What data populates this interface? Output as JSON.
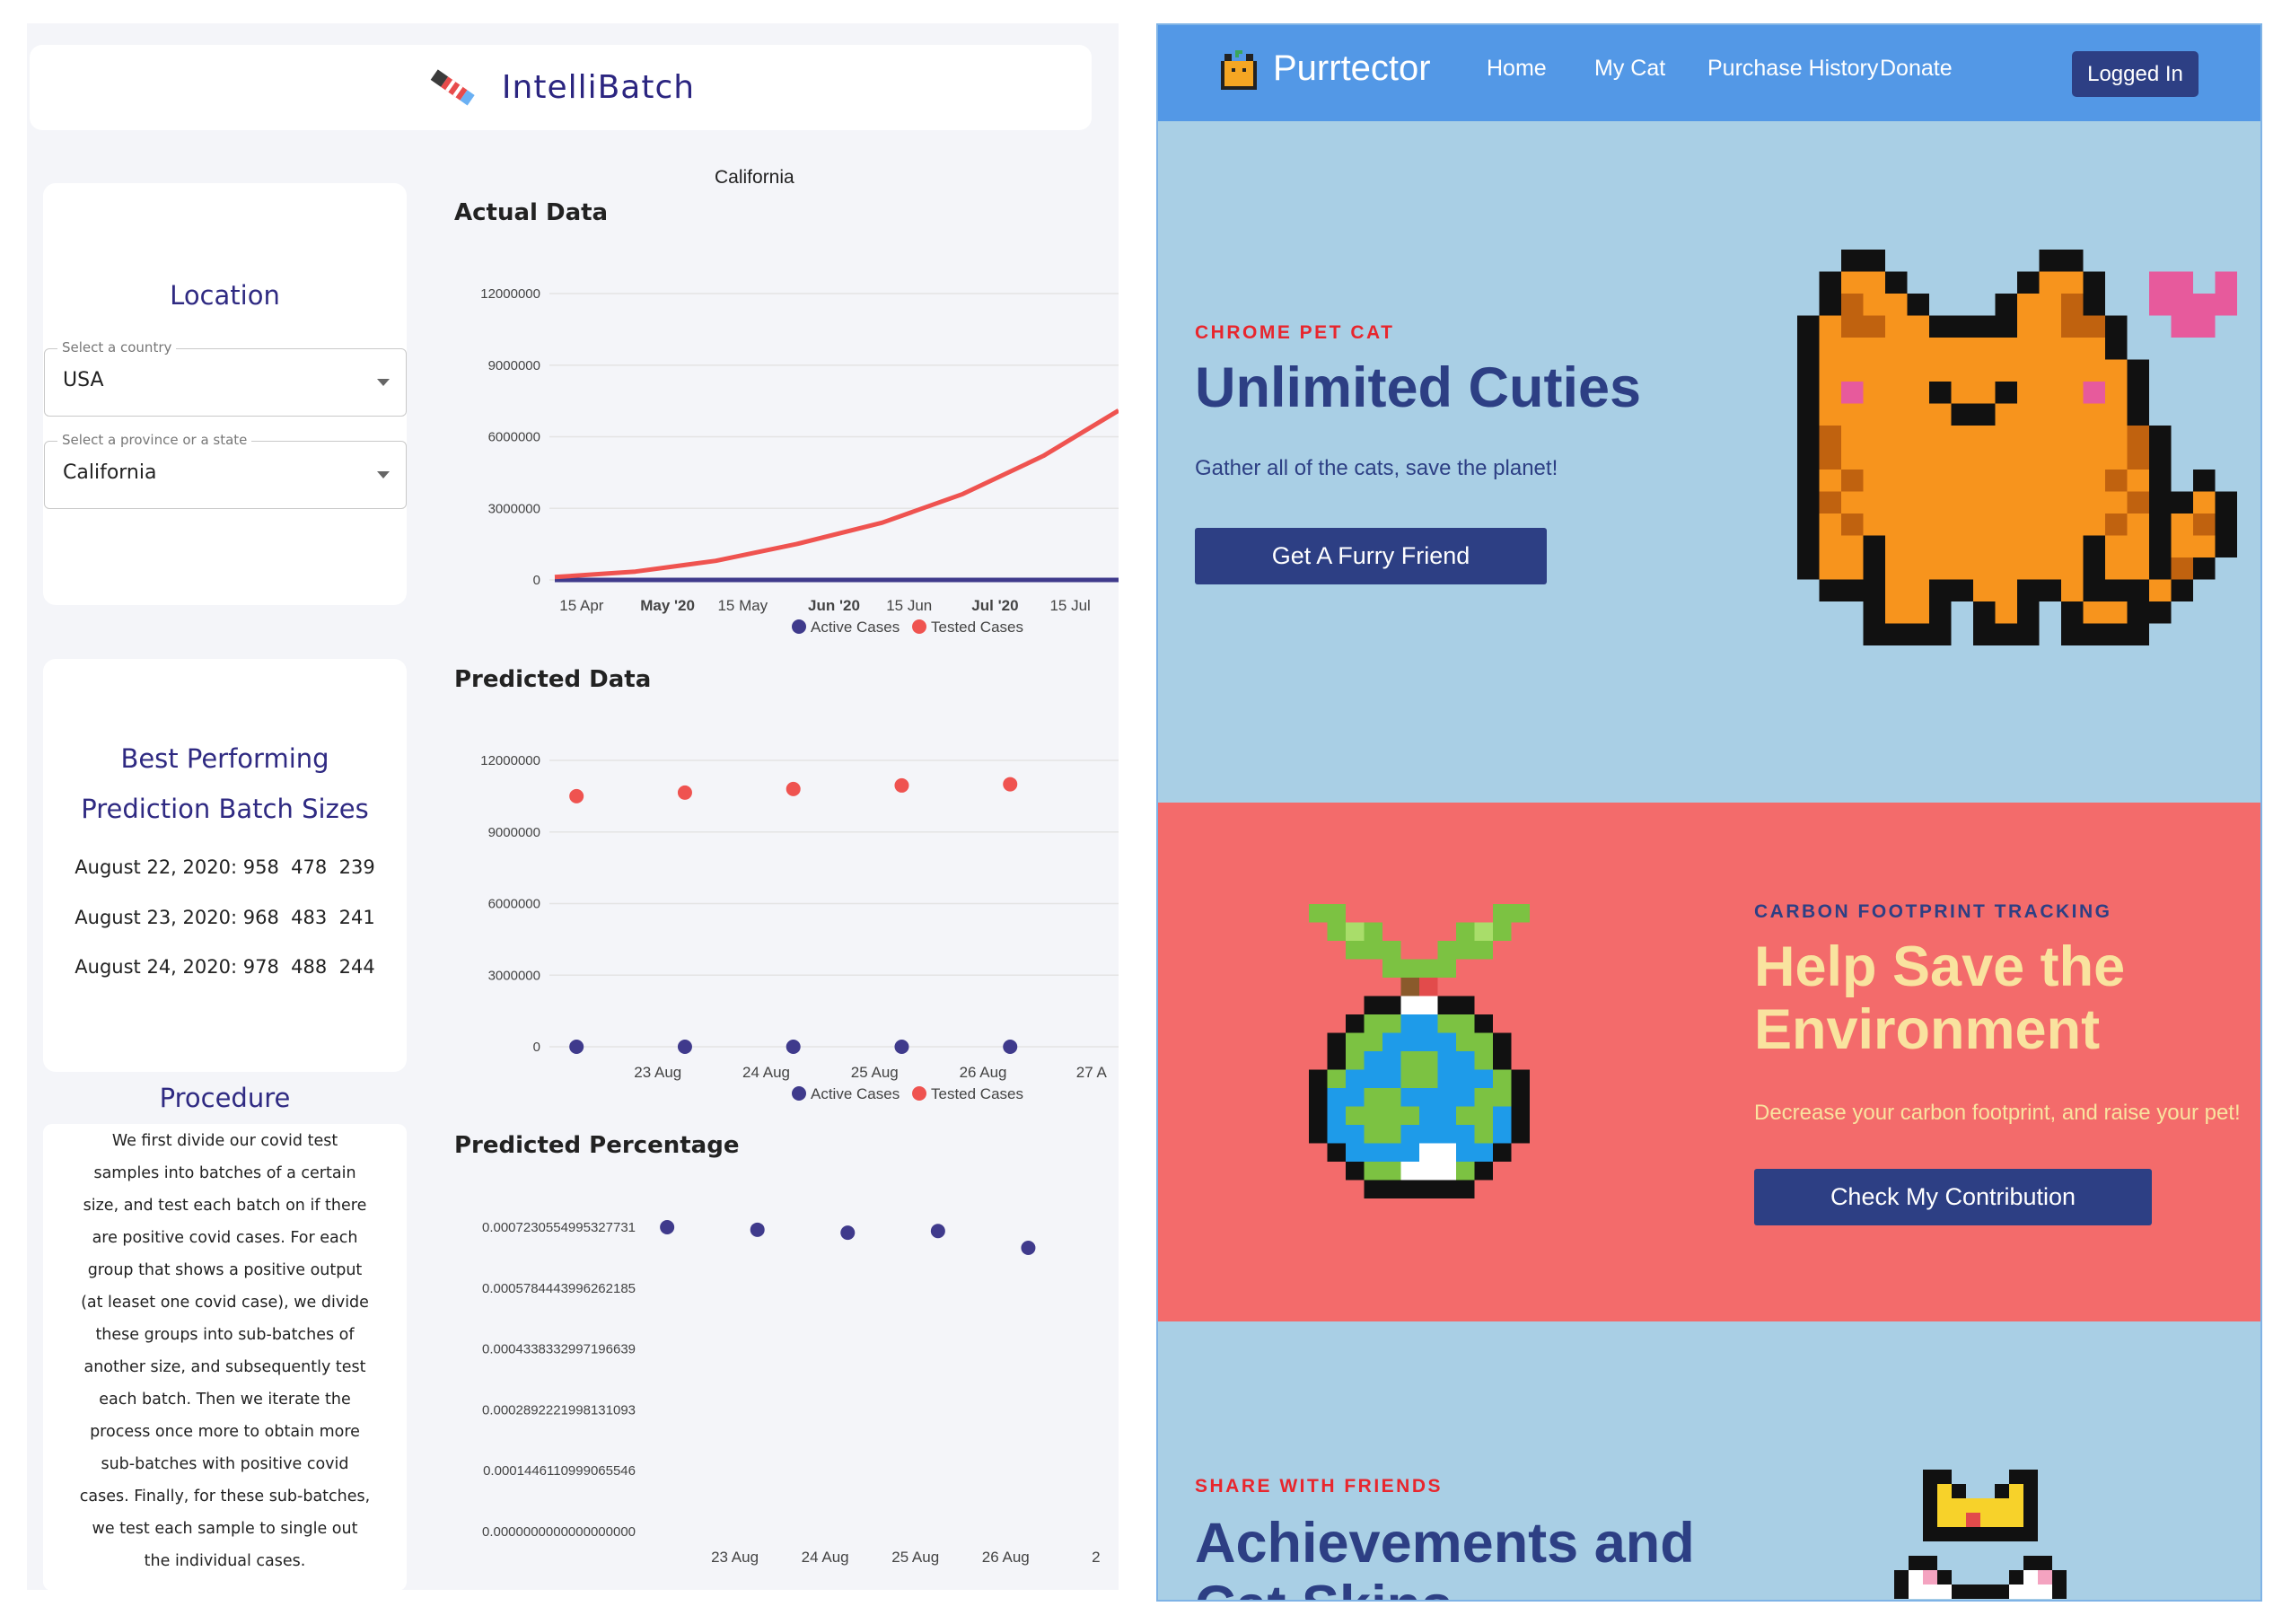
{
  "intellibatch": {
    "brand": "IntelliBatch",
    "location": {
      "title": "Location",
      "country_label": "Select a country",
      "country_value": "USA",
      "state_label": "Select a province or a state",
      "state_value": "California"
    },
    "best": {
      "title_line1": "Best Performing",
      "title_line2": "Prediction Batch Sizes",
      "rows": [
        "August 22, 2020: 958  478  239",
        "August 23, 2020: 968  483  241",
        "August 24, 2020: 978  488  244"
      ]
    },
    "procedure": {
      "title": "Procedure",
      "lines": [
        "We first divide our covid test",
        "samples into batches of a certain",
        "size, and test each batch on if there",
        "are positive covid cases. For each",
        "group that shows a positive output",
        "(at leaset one covid case), we divide",
        "these groups into sub-batches of",
        "another size, and subsequently test",
        "each batch. Then we iterate the",
        "process once more to obtain more",
        "sub-batches with positive covid",
        "cases. Finally, for these sub-batches,",
        "we test each sample to single out",
        "the individual cases."
      ]
    },
    "charts_header": "California",
    "colors": {
      "active": "#3f3a8c",
      "tested": "#ef5350"
    }
  },
  "chart_data": [
    {
      "type": "line",
      "title": "Actual Data",
      "x_ticks": [
        "15 Apr",
        "May '20",
        "15 May",
        "Jun '20",
        "15 Jun",
        "Jul '20",
        "15 Jul"
      ],
      "y_ticks": [
        "12000000",
        "9000000",
        "6000000",
        "3000000",
        "0"
      ],
      "ylim": [
        0,
        12000000
      ],
      "series": [
        {
          "name": "Active Cases",
          "x": [
            "2020-04-10",
            "2020-07-24"
          ],
          "values": [
            0,
            0
          ]
        },
        {
          "name": "Tested Cases",
          "x": [
            "2020-04-10",
            "2020-04-25",
            "2020-05-10",
            "2020-05-25",
            "2020-06-10",
            "2020-06-25",
            "2020-07-10",
            "2020-07-24"
          ],
          "values": [
            120000,
            350000,
            800000,
            1500000,
            2400000,
            3600000,
            5200000,
            7100000
          ]
        }
      ],
      "legend": [
        "Active Cases",
        "Tested Cases"
      ],
      "legend_position": "bottom",
      "grid": true
    },
    {
      "type": "scatter",
      "title": "Predicted Data",
      "x_ticks": [
        "23 Aug",
        "24 Aug",
        "25 Aug",
        "26 Aug",
        "27 A"
      ],
      "y_ticks": [
        "12000000",
        "9000000",
        "6000000",
        "3000000",
        "0"
      ],
      "ylim": [
        0,
        12000000
      ],
      "series": [
        {
          "name": "Active Cases",
          "x": [
            "2020-08-22",
            "2020-08-23",
            "2020-08-24",
            "2020-08-25",
            "2020-08-26"
          ],
          "values": [
            0,
            0,
            0,
            0,
            0
          ]
        },
        {
          "name": "Tested Cases",
          "x": [
            "2020-08-22",
            "2020-08-23",
            "2020-08-24",
            "2020-08-25",
            "2020-08-26"
          ],
          "values": [
            10500000,
            10650000,
            10800000,
            10950000,
            11000000
          ]
        }
      ],
      "legend": [
        "Active Cases",
        "Tested Cases"
      ],
      "legend_position": "bottom",
      "grid": true
    },
    {
      "type": "scatter",
      "title": "Predicted Percentage",
      "x_ticks": [
        "23 Aug",
        "24 Aug",
        "25 Aug",
        "26 Aug",
        "2"
      ],
      "y_ticks": [
        "0.0007230554995327731",
        "0.0005784443996262185",
        "0.0004338332997196639",
        "0.0002892221998131093",
        "0.0001446110999065546",
        "0.0000000000000000000"
      ],
      "ylim": [
        0,
        0.0007230554995327731
      ],
      "series": [
        {
          "x": [
            "2020-08-22",
            "2020-08-23",
            "2020-08-24",
            "2020-08-25",
            "2020-08-26"
          ],
          "values": [
            0.000723,
            0.000717,
            0.00071,
            0.000714,
            0.000674
          ]
        }
      ],
      "grid": false
    }
  ],
  "purrtector": {
    "brand": "Purrtector",
    "nav": [
      "Home",
      "My Cat",
      "Purchase History",
      "Donate"
    ],
    "login": "Logged In",
    "hero": {
      "eyebrow": "CHROME PET CAT",
      "title": "Unlimited Cuties",
      "subtitle": "Gather all of the cats, save the planet!",
      "button": "Get A Furry Friend"
    },
    "env": {
      "eyebrow": "CARBON FOOTPRINT TRACKING",
      "title_line1": "Help Save the",
      "title_line2": "Environment",
      "subtitle": "Decrease your carbon footprint, and raise your pet!",
      "button": "Check My Contribution"
    },
    "share": {
      "eyebrow": "SHARE WITH FRIENDS",
      "title_line1": "Achievements and",
      "title_line2": "Cat Skins"
    },
    "colors": {
      "nav": "#5398e6",
      "hero_bg": "#a9cfe5",
      "env_bg": "#f36b6b",
      "eyebrow_red": "#e8262d",
      "navy": "#2d3f84",
      "cream": "#f9e39f"
    }
  }
}
